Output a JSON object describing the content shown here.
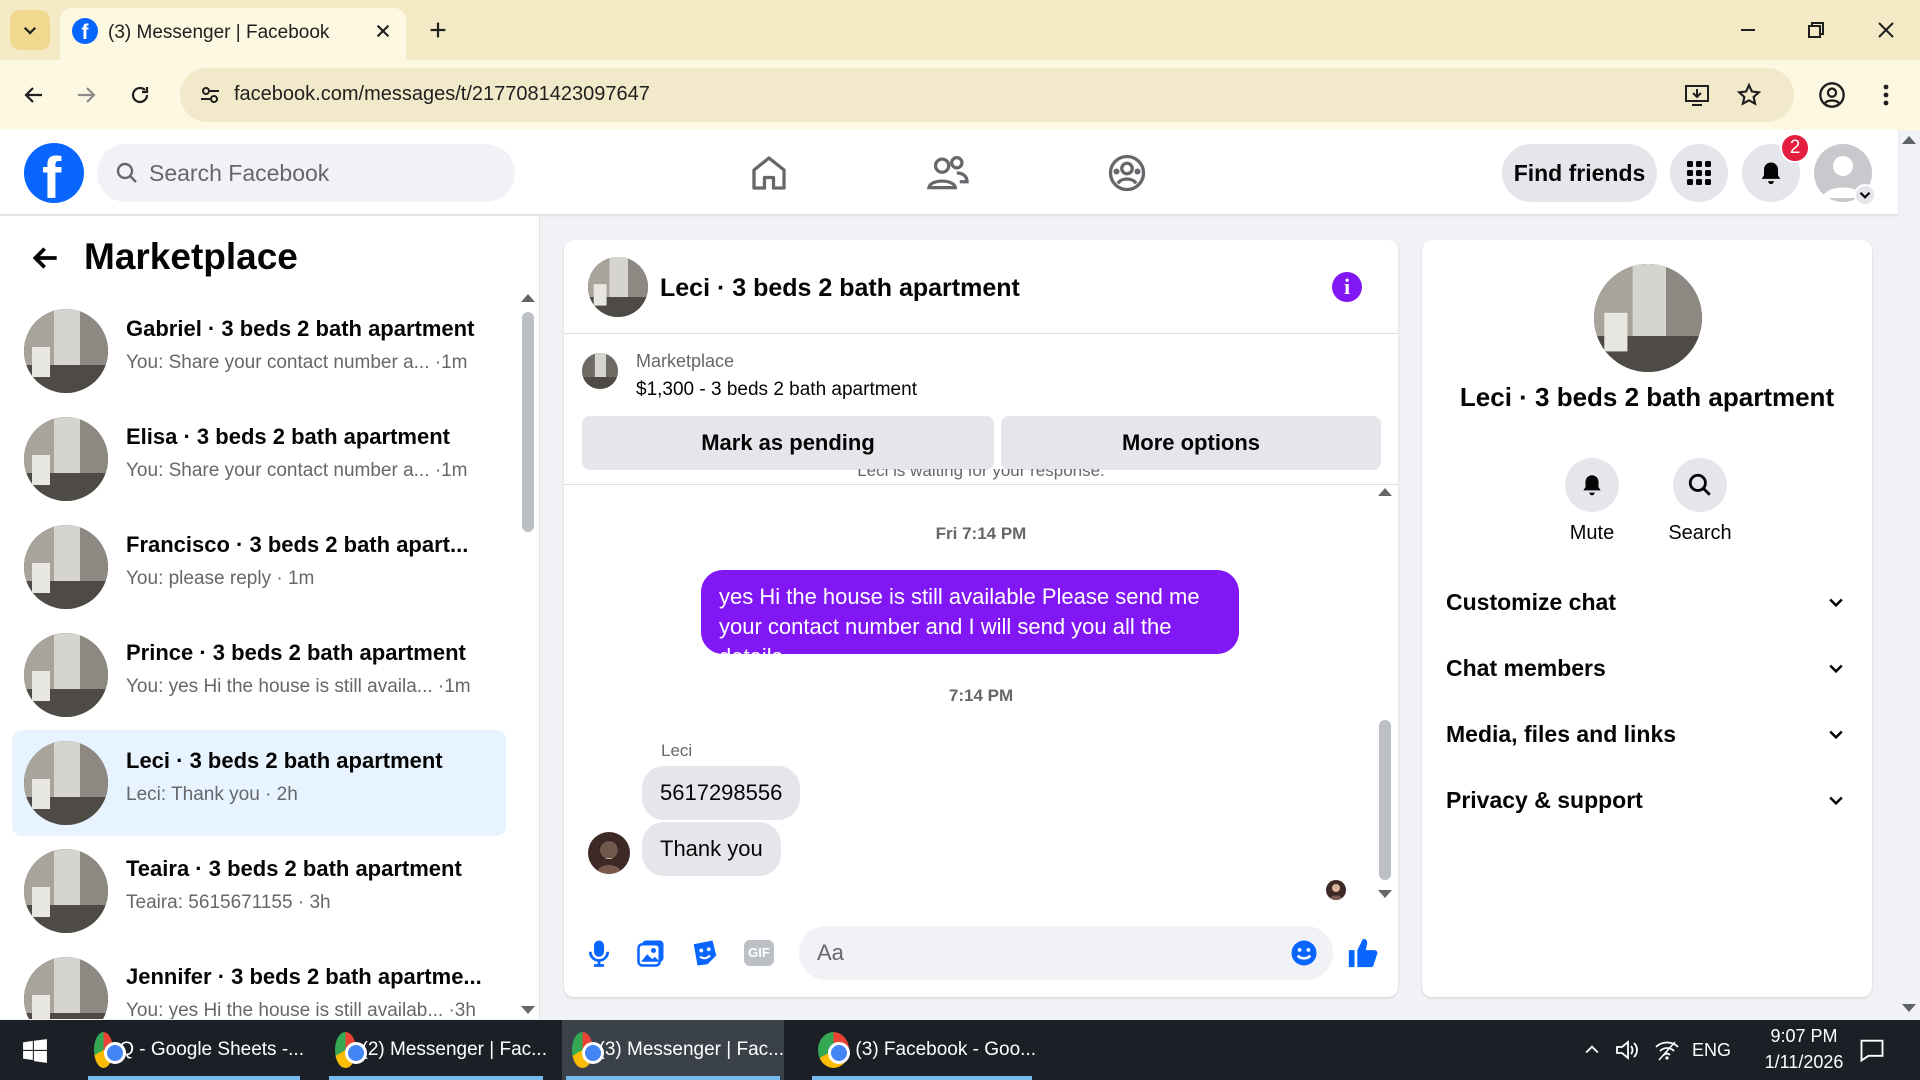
{
  "browser": {
    "tab_title": "(3) Messenger | Facebook",
    "url": "facebook.com/messages/t/2177081423097647"
  },
  "fb": {
    "search_placeholder": "Search Facebook",
    "find_friends": "Find friends",
    "notification_count": "2"
  },
  "left_pane": {
    "title": "Marketplace",
    "conversations": [
      {
        "name": "Gabriel · 3 beds 2 bath apartment",
        "preview": "You: Share your contact number a... ·1m",
        "selected": false
      },
      {
        "name": "Elisa · 3 beds 2 bath apartment",
        "preview": "You: Share your contact number a... ·1m",
        "selected": false
      },
      {
        "name": "Francisco · 3 beds 2 bath apart...",
        "preview": "You: please reply · 1m",
        "selected": false
      },
      {
        "name": "Prince · 3 beds 2 bath apartment",
        "preview": "You: yes Hi the house is still availa... ·1m",
        "selected": false
      },
      {
        "name": "Leci · 3 beds 2 bath apartment",
        "preview": "Leci: Thank you · 2h",
        "selected": true
      },
      {
        "name": "Teaira · 3 beds 2 bath apartment",
        "preview": "Teaira: 5615671155 · 3h",
        "selected": false
      },
      {
        "name": "Jennifer · 3 beds 2 bath apartme...",
        "preview": "You: yes Hi the house is still availab... ·3h",
        "selected": false
      }
    ]
  },
  "chat": {
    "title": "Leci · 3 beds 2 bath apartment",
    "marketplace_label": "Marketplace",
    "listing": "$1,300 - 3 beds 2 bath apartment",
    "mark_pending": "Mark as pending",
    "more_options": "More options",
    "waiting_text": "Leci is waiting for your response.",
    "timestamp_1": "Fri 7:14 PM",
    "outgoing_message": "yes Hi the house is still available Please send me your contact number and I will send you all the details",
    "timestamp_2": "7:14 PM",
    "sender_name": "Leci",
    "incoming_1": "5617298556",
    "incoming_2": "Thank you",
    "composer_placeholder": "Aa"
  },
  "right_pane": {
    "name": "Leci · 3 beds 2 bath apartment",
    "mute_label": "Mute",
    "search_label": "Search",
    "sections": [
      "Customize chat",
      "Chat members",
      "Media, files and links",
      "Privacy & support"
    ]
  },
  "taskbar": {
    "tasks": [
      {
        "label": "Q - Google Sheets -...",
        "active": false
      },
      {
        "label": "(2) Messenger | Fac...",
        "active": false
      },
      {
        "label": "(3) Messenger | Fac...",
        "active": true
      },
      {
        "label": "(3) Facebook - Goo...",
        "active": false
      }
    ],
    "language": "ENG",
    "time": "9:07 PM",
    "date": "1/11/2026"
  },
  "colors": {
    "fb_blue": "#0866ff",
    "messenger_purple": "#8217f5",
    "selected_bg": "#e7f3ff",
    "chrome_tabstrip": "#f4ebc6"
  }
}
